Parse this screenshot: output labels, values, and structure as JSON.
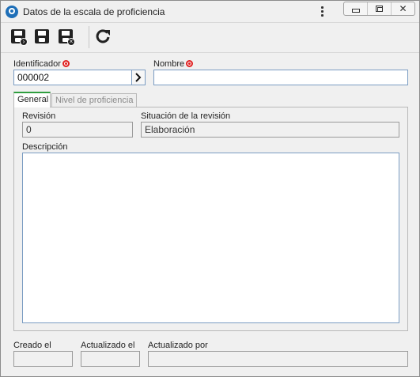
{
  "window": {
    "title": "Datos de la escala de proficiencia",
    "close_glyph": "✕"
  },
  "toolbar": {
    "icons": [
      "save-and-new-icon",
      "save-icon",
      "save-and-close-icon",
      "refresh-icon"
    ]
  },
  "form": {
    "identificador_label": "Identificador",
    "identificador_value": "000002",
    "nombre_label": "Nombre",
    "nombre_value": ""
  },
  "tabs": [
    {
      "label": "General",
      "active": true
    },
    {
      "label": "Nivel de proficiencia",
      "active": false
    }
  ],
  "general": {
    "revision_label": "Revisión",
    "revision_value": "0",
    "situacion_label": "Situación de la revisión",
    "situacion_value": "Elaboración",
    "descripcion_label": "Descripción",
    "descripcion_value": ""
  },
  "footer": {
    "creado_label": "Creado el",
    "creado_value": "",
    "actualizado_label": "Actualizado el",
    "actualizado_value": "",
    "actualizado_por_label": "Actualizado por",
    "actualizado_por_value": ""
  },
  "colors": {
    "required_marker": "#e02020",
    "active_tab_accent": "#2f9e3f",
    "field_border": "#7a9cc2"
  }
}
